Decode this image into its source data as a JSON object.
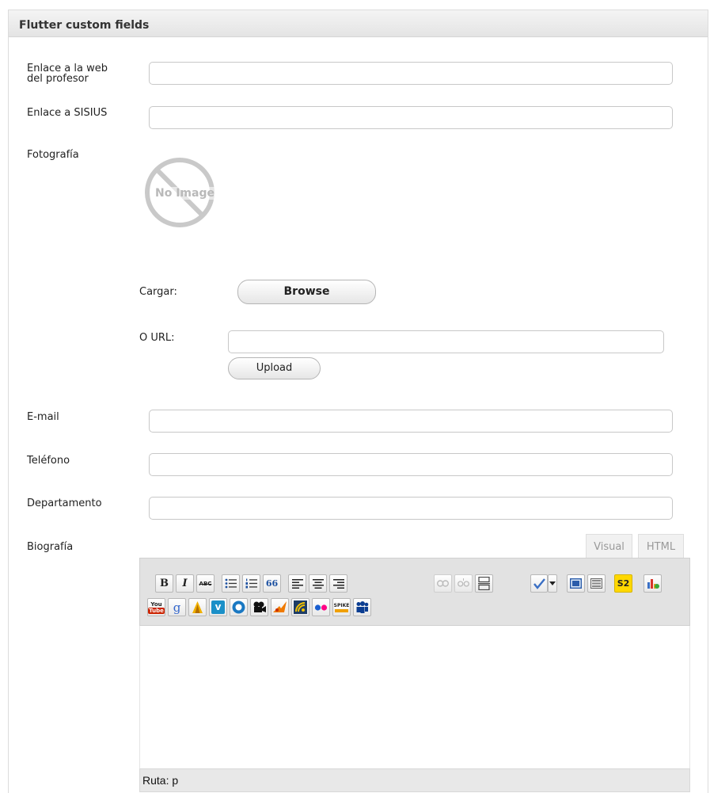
{
  "panel": {
    "title": "Flutter custom fields"
  },
  "fields": {
    "web_label_line1": "Enlace a la web",
    "web_label_line2": "del profesor",
    "web_value": "",
    "sisius_label": "Enlace a SISIUS",
    "sisius_value": "",
    "foto_label": "Fotografía",
    "no_image_text": "No Image",
    "cargar_label": "Cargar:",
    "browse_label": "Browse",
    "ourl_label": "O URL:",
    "ourl_value": "",
    "upload_label": "Upload",
    "email_label": "E-mail",
    "email_value": "",
    "telefono_label": "Teléfono",
    "telefono_value": "",
    "departamento_label": "Departamento",
    "departamento_value": "",
    "biografia_label": "Biografía"
  },
  "editor": {
    "tab_visual": "Visual",
    "tab_html": "HTML",
    "status_path": "Ruta: p",
    "colors": {
      "toolbar_bg": "#e2e2e2",
      "s2_yellow": "#ffd800",
      "vimeo_blue": "#1b90c8",
      "youtube_red": "#cc2200"
    },
    "row1_icons": [
      "bold-icon",
      "italic-icon",
      "strikethrough-icon",
      "bullet-list-icon",
      "numbered-list-icon",
      "blockquote-icon",
      "align-left-icon",
      "align-center-icon",
      "align-right-icon",
      "link-icon",
      "unlink-icon",
      "more-tag-icon",
      "spellcheck-icon",
      "fullscreen-icon",
      "kitchen-sink-icon",
      "s2-icon",
      "chart-icon"
    ],
    "row2_icons": [
      "youtube-icon",
      "google-video-icon",
      "dailymotion-icon",
      "vimeo-icon",
      "video-play-icon",
      "metacafe-icon",
      "revver-icon",
      "ifilm-icon",
      "flickr-icon",
      "spike-icon",
      "myspace-icon"
    ]
  },
  "toolbar_text": {
    "bold": "B",
    "italic": "I",
    "strike": "ABC",
    "quote": "66",
    "s2": "S2",
    "youtube_top": "You",
    "youtube_bottom": "Tube",
    "google": "g",
    "vimeo": "v",
    "spike": "SPIKE"
  }
}
